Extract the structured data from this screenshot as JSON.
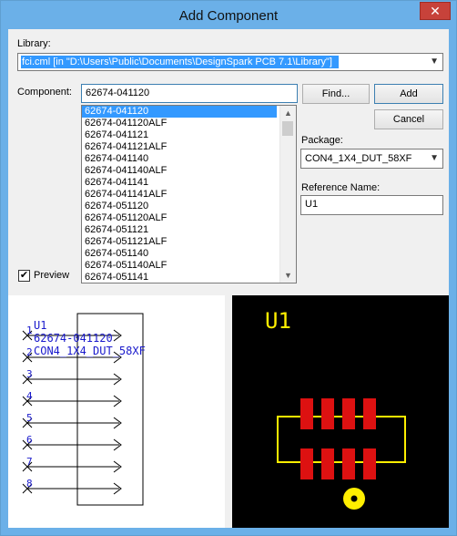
{
  "window": {
    "title": "Add Component",
    "close_glyph": "✕"
  },
  "library": {
    "label": "Library:",
    "value": "fci.cml   [in \"D:\\Users\\Public\\Documents\\DesignSpark PCB 7.1\\Library\"]"
  },
  "component": {
    "label": "Component:",
    "value": "62674-041120",
    "items": [
      "62674-041120",
      "62674-041120ALF",
      "62674-041121",
      "62674-041121ALF",
      "62674-041140",
      "62674-041140ALF",
      "62674-041141",
      "62674-041141ALF",
      "62674-051120",
      "62674-051120ALF",
      "62674-051121",
      "62674-051121ALF",
      "62674-051140",
      "62674-051140ALF",
      "62674-051141"
    ],
    "selected_index": 0
  },
  "buttons": {
    "find": "Find...",
    "add": "Add",
    "cancel": "Cancel"
  },
  "package": {
    "label": "Package:",
    "value": "CON4_1X4_DUT_58XF"
  },
  "reference": {
    "label": "Reference Name:",
    "value": "U1"
  },
  "preview": {
    "label": "Preview",
    "checked": true,
    "check_glyph": "✔"
  },
  "schematic": {
    "ref": "U1",
    "part": "62674-041120",
    "package": "CON4_1X4_DUT_58XF",
    "pins": [
      "1",
      "2",
      "3",
      "4",
      "5",
      "6",
      "7",
      "8"
    ],
    "color": "#1a1acc"
  },
  "pcb": {
    "ref": "U1",
    "colors": {
      "background": "#000000",
      "outline": "#ffee00",
      "pad": "#dd1111",
      "text": "#ffee00"
    }
  }
}
